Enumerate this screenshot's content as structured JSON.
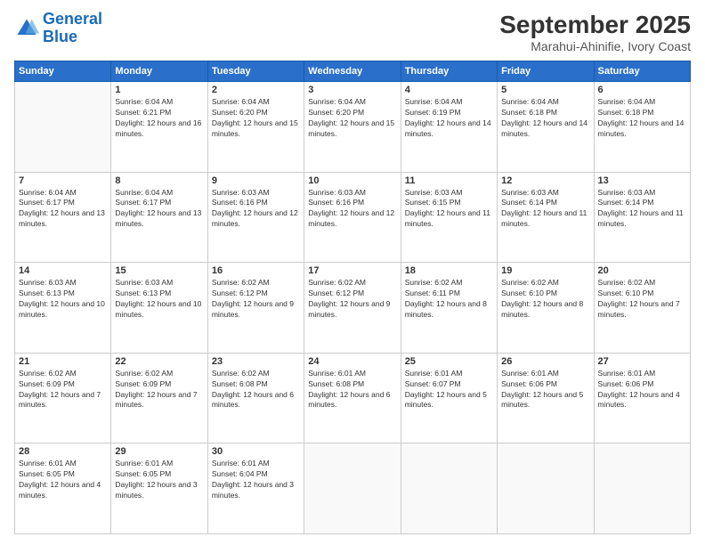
{
  "logo": {
    "line1": "General",
    "line2": "Blue"
  },
  "title": "September 2025",
  "subtitle": "Marahui-Ahinifie, Ivory Coast",
  "weekdays": [
    "Sunday",
    "Monday",
    "Tuesday",
    "Wednesday",
    "Thursday",
    "Friday",
    "Saturday"
  ],
  "weeks": [
    [
      {
        "day": null
      },
      {
        "day": "1",
        "sunrise": "6:04 AM",
        "sunset": "6:21 PM",
        "daylight": "12 hours and 16 minutes."
      },
      {
        "day": "2",
        "sunrise": "6:04 AM",
        "sunset": "6:20 PM",
        "daylight": "12 hours and 15 minutes."
      },
      {
        "day": "3",
        "sunrise": "6:04 AM",
        "sunset": "6:20 PM",
        "daylight": "12 hours and 15 minutes."
      },
      {
        "day": "4",
        "sunrise": "6:04 AM",
        "sunset": "6:19 PM",
        "daylight": "12 hours and 14 minutes."
      },
      {
        "day": "5",
        "sunrise": "6:04 AM",
        "sunset": "6:18 PM",
        "daylight": "12 hours and 14 minutes."
      },
      {
        "day": "6",
        "sunrise": "6:04 AM",
        "sunset": "6:18 PM",
        "daylight": "12 hours and 14 minutes."
      }
    ],
    [
      {
        "day": "7",
        "sunrise": "6:04 AM",
        "sunset": "6:17 PM",
        "daylight": "12 hours and 13 minutes."
      },
      {
        "day": "8",
        "sunrise": "6:04 AM",
        "sunset": "6:17 PM",
        "daylight": "12 hours and 13 minutes."
      },
      {
        "day": "9",
        "sunrise": "6:03 AM",
        "sunset": "6:16 PM",
        "daylight": "12 hours and 12 minutes."
      },
      {
        "day": "10",
        "sunrise": "6:03 AM",
        "sunset": "6:16 PM",
        "daylight": "12 hours and 12 minutes."
      },
      {
        "day": "11",
        "sunrise": "6:03 AM",
        "sunset": "6:15 PM",
        "daylight": "12 hours and 11 minutes."
      },
      {
        "day": "12",
        "sunrise": "6:03 AM",
        "sunset": "6:14 PM",
        "daylight": "12 hours and 11 minutes."
      },
      {
        "day": "13",
        "sunrise": "6:03 AM",
        "sunset": "6:14 PM",
        "daylight": "12 hours and 11 minutes."
      }
    ],
    [
      {
        "day": "14",
        "sunrise": "6:03 AM",
        "sunset": "6:13 PM",
        "daylight": "12 hours and 10 minutes."
      },
      {
        "day": "15",
        "sunrise": "6:03 AM",
        "sunset": "6:13 PM",
        "daylight": "12 hours and 10 minutes."
      },
      {
        "day": "16",
        "sunrise": "6:02 AM",
        "sunset": "6:12 PM",
        "daylight": "12 hours and 9 minutes."
      },
      {
        "day": "17",
        "sunrise": "6:02 AM",
        "sunset": "6:12 PM",
        "daylight": "12 hours and 9 minutes."
      },
      {
        "day": "18",
        "sunrise": "6:02 AM",
        "sunset": "6:11 PM",
        "daylight": "12 hours and 8 minutes."
      },
      {
        "day": "19",
        "sunrise": "6:02 AM",
        "sunset": "6:10 PM",
        "daylight": "12 hours and 8 minutes."
      },
      {
        "day": "20",
        "sunrise": "6:02 AM",
        "sunset": "6:10 PM",
        "daylight": "12 hours and 7 minutes."
      }
    ],
    [
      {
        "day": "21",
        "sunrise": "6:02 AM",
        "sunset": "6:09 PM",
        "daylight": "12 hours and 7 minutes."
      },
      {
        "day": "22",
        "sunrise": "6:02 AM",
        "sunset": "6:09 PM",
        "daylight": "12 hours and 7 minutes."
      },
      {
        "day": "23",
        "sunrise": "6:02 AM",
        "sunset": "6:08 PM",
        "daylight": "12 hours and 6 minutes."
      },
      {
        "day": "24",
        "sunrise": "6:01 AM",
        "sunset": "6:08 PM",
        "daylight": "12 hours and 6 minutes."
      },
      {
        "day": "25",
        "sunrise": "6:01 AM",
        "sunset": "6:07 PM",
        "daylight": "12 hours and 5 minutes."
      },
      {
        "day": "26",
        "sunrise": "6:01 AM",
        "sunset": "6:06 PM",
        "daylight": "12 hours and 5 minutes."
      },
      {
        "day": "27",
        "sunrise": "6:01 AM",
        "sunset": "6:06 PM",
        "daylight": "12 hours and 4 minutes."
      }
    ],
    [
      {
        "day": "28",
        "sunrise": "6:01 AM",
        "sunset": "6:05 PM",
        "daylight": "12 hours and 4 minutes."
      },
      {
        "day": "29",
        "sunrise": "6:01 AM",
        "sunset": "6:05 PM",
        "daylight": "12 hours and 3 minutes."
      },
      {
        "day": "30",
        "sunrise": "6:01 AM",
        "sunset": "6:04 PM",
        "daylight": "12 hours and 3 minutes."
      },
      {
        "day": null
      },
      {
        "day": null
      },
      {
        "day": null
      },
      {
        "day": null
      }
    ]
  ]
}
